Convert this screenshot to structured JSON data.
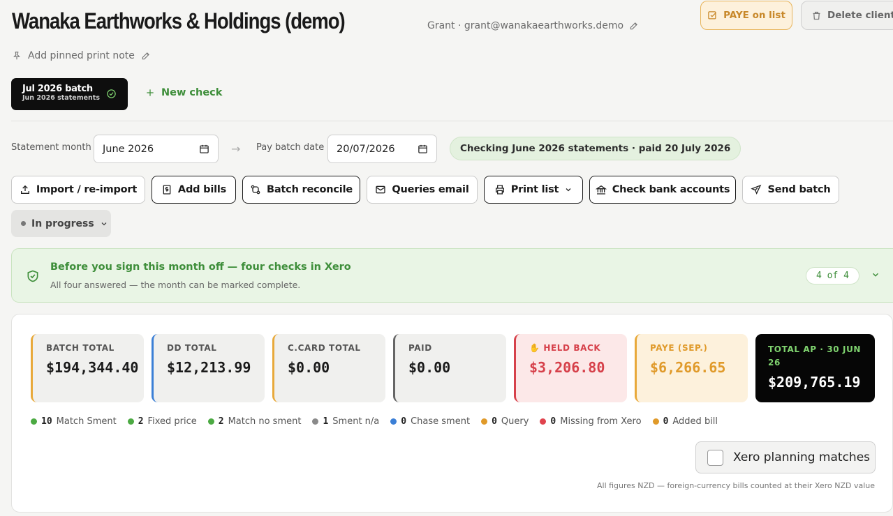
{
  "header": {
    "title": "Wanaka Earthworks & Holdings (demo)",
    "contact": "Grant · grant@wanakaearthworks.demo",
    "paye_label": "PAYE on list",
    "delete_label": "Delete client",
    "pinned_note": "Add pinned print note"
  },
  "batch_tab": {
    "title": "Jul 2026 batch",
    "subtitle": "Jun 2026 statements"
  },
  "new_check_label": "New check",
  "period": {
    "statement_month_label": "Statement month",
    "statement_month_value": "June 2026",
    "pay_batch_label": "Pay batch date",
    "pay_batch_value": "20/07/2026",
    "checking_text": "Checking June 2026 statements · paid 20 July 2026"
  },
  "toolbar": {
    "import": "Import / re-import",
    "add_bills": "Add bills",
    "reconcile": "Batch reconcile",
    "queries": "Queries email",
    "print": "Print list",
    "bank": "Check bank accounts",
    "send": "Send batch"
  },
  "status": "In progress",
  "signoff": {
    "title": "Before you sign this month off — four checks in Xero",
    "subtitle": "All four answered — the month can be marked complete.",
    "count": "4 of 4"
  },
  "totals": [
    {
      "label": "BATCH TOTAL",
      "value": "$194,344.40",
      "accent": "#e8a93a"
    },
    {
      "label": "DD TOTAL",
      "value": "$12,213.99",
      "accent": "#3b7fd6"
    },
    {
      "label": "C.CARD TOTAL",
      "value": "$0.00",
      "accent": "#e8a93a"
    },
    {
      "label": "PAID",
      "value": "$0.00",
      "accent": "#666666"
    },
    {
      "label": "✋ HELD BACK",
      "value": "$3,206.80",
      "accent": "#d6404a"
    },
    {
      "label": "PAYE (SEP.)",
      "value": "$6,266.65",
      "accent": "#e8a93a"
    },
    {
      "label": "TOTAL AP · 30 JUN 26",
      "value": "$209,765.19",
      "accent": "#7fd36f"
    }
  ],
  "legend": [
    {
      "count": "10",
      "label": "Match Sment",
      "color": "#4caa43"
    },
    {
      "count": "2",
      "label": "Fixed price",
      "color": "#4caa43"
    },
    {
      "count": "2",
      "label": "Match no sment",
      "color": "#4caa43"
    },
    {
      "count": "1",
      "label": "Sment n/a",
      "color": "#8a8a8a"
    },
    {
      "count": "0",
      "label": "Chase sment",
      "color": "#3b7fd6"
    },
    {
      "count": "0",
      "label": "Query",
      "color": "#e09a2a"
    },
    {
      "count": "0",
      "label": "Missing from Xero",
      "color": "#e0444e"
    },
    {
      "count": "0",
      "label": "Added bill",
      "color": "#e09a2a"
    }
  ],
  "xero_planning_label": "Xero planning matches",
  "footnote": "All figures NZD — foreign-currency bills counted at their Xero NZD value"
}
